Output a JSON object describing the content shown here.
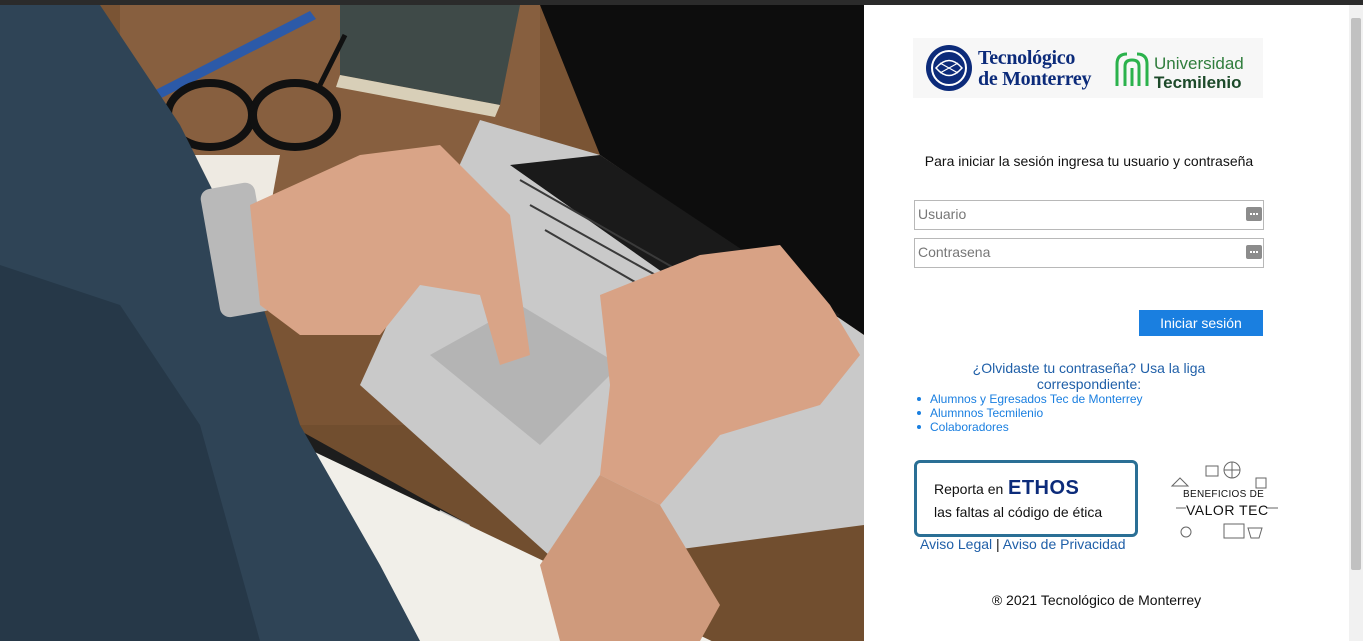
{
  "login": {
    "instructions": "Para iniciar la sesión ingresa tu usuario y contraseña",
    "username_placeholder": "Usuario",
    "password_placeholder": "Contrasena",
    "submit_label": "Iniciar sesión"
  },
  "logos": {
    "tec_line1": "Tecnológico",
    "tec_line2": "de Monterrey",
    "tecmilenio_line1": "Universidad",
    "tecmilenio_line2": "Tecmilenio"
  },
  "forgot_password": {
    "heading": "¿Olvidaste tu contraseña? Usa la liga correspondiente:",
    "links": [
      "Alumnos y Egresados Tec de Monterrey",
      "Alumnnos Tecmilenio",
      "Colaboradores"
    ]
  },
  "ethos": {
    "prefix": "Reporta en",
    "brand": "ETHOS",
    "line2": "las faltas al código de ética"
  },
  "valor_tec": {
    "line1": "BENEFICIOS DE",
    "line2": "VALOR TEC"
  },
  "legal": {
    "aviso_legal": "Aviso Legal",
    "separator": "|",
    "aviso_privacidad": "Aviso de Privacidad"
  },
  "footer": {
    "copyright": "® 2021 Tecnológico de Monterrey"
  },
  "colors": {
    "primary_button": "#1a7fe0",
    "link_blue": "#1f5fa8",
    "tec_blue": "#0c2b7a",
    "tecmilenio_green": "#2f7d3c",
    "ethos_border": "#2a6f95"
  },
  "icons": {
    "field_icon": "password-manager-key-icon"
  }
}
